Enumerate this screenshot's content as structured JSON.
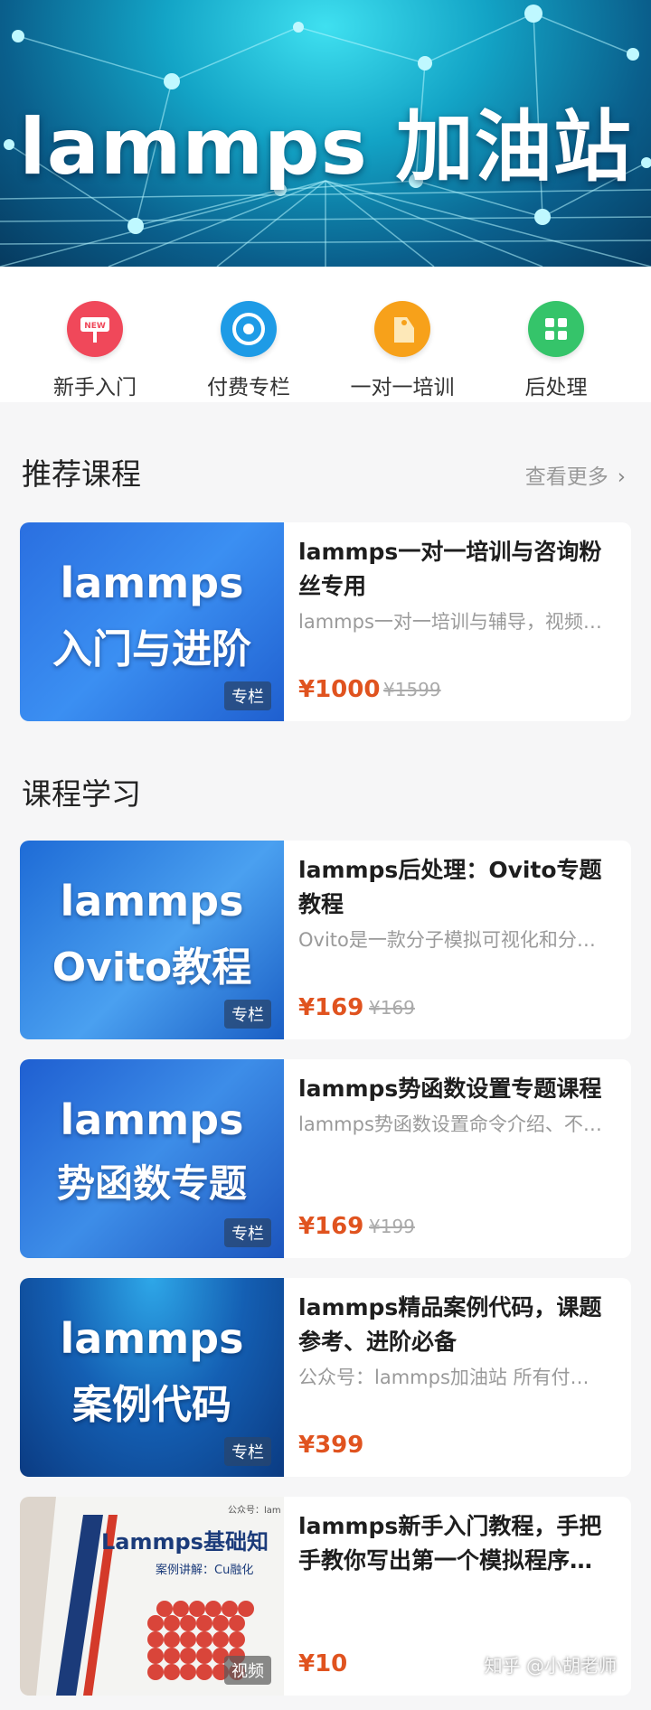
{
  "banner": {
    "title": "lammps 加油站"
  },
  "quick_nav": [
    {
      "label": "新手入门",
      "icon": "new-sign-icon",
      "color": "#f0485a"
    },
    {
      "label": "付费专栏",
      "icon": "column-icon",
      "color": "#1e9be6"
    },
    {
      "label": "一对一培训",
      "icon": "tag-icon",
      "color": "#f7a11a"
    },
    {
      "label": "后处理",
      "icon": "grid-icon",
      "color": "#35c46a"
    }
  ],
  "recommended": {
    "title": "推荐课程",
    "more_label": "查看更多",
    "items": [
      {
        "thumb_lines": [
          "lammps",
          "入门与进阶"
        ],
        "badge": "专栏",
        "title": "lammps一对一培训与咨询粉丝专用",
        "desc": "lammps一对一培训与辅导，视频…",
        "price": "¥1000",
        "original_price": "¥1599"
      }
    ]
  },
  "courses": {
    "title": "课程学习",
    "items": [
      {
        "thumb_lines": [
          "lammps",
          "Ovito教程"
        ],
        "badge": "专栏",
        "title": "lammps后处理：Ovito专题教程",
        "desc": "Ovito是一款分子模拟可视化和分…",
        "price": "¥169",
        "original_price": "¥169"
      },
      {
        "thumb_lines": [
          "lammps",
          "势函数专题"
        ],
        "badge": "专栏",
        "title": "lammps势函数设置专题课程",
        "desc": "lammps势函数设置命令介绍、不…",
        "price": "¥169",
        "original_price": "¥199"
      },
      {
        "thumb_lines": [
          "lammps",
          "案例代码"
        ],
        "badge": "专栏",
        "title": "lammps精品案例代码，课题参考、进阶必备",
        "desc": "公众号：lammps加油站 所有付…",
        "price": "¥399",
        "original_price": ""
      },
      {
        "thumb_lines": [
          "Lammps基础知",
          "案例讲解：Cu融化",
          "公众号：lam"
        ],
        "badge": "视频",
        "title": "lammps新手入门教程，手把手教你写出第一个模拟程序…",
        "desc": "",
        "price": "¥10",
        "original_price": ""
      }
    ]
  },
  "watermark": "知乎 @小胡老师"
}
